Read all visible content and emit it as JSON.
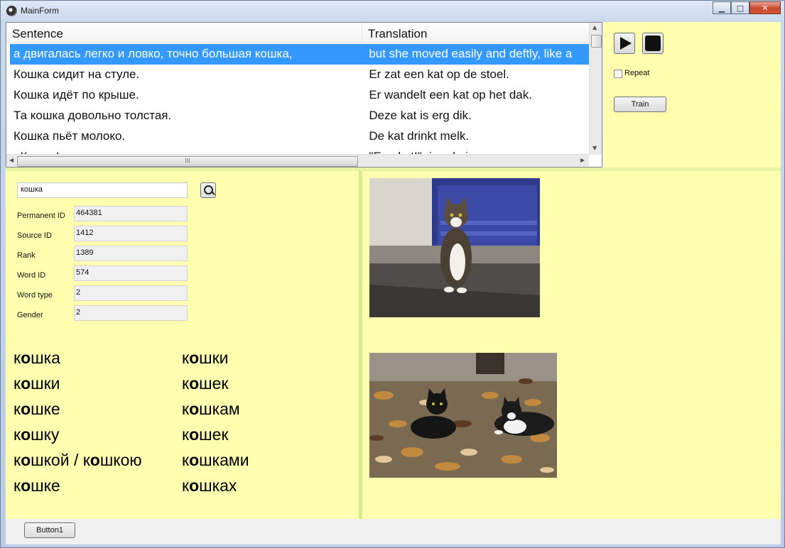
{
  "window": {
    "title": "MainForm",
    "close_glyph": "✕",
    "minimize_glyph": "▁",
    "maximize_glyph": "□"
  },
  "grid": {
    "columns": [
      "Sentence",
      "Translation"
    ],
    "rows": [
      {
        "sentence": "а двигалась легко и ловко, точно большая кошка,",
        "translation": "but she moved easily and deftly, like a"
      },
      {
        "sentence": "Кошка сидит на стуле.",
        "translation": "Er zat een kat op de stoel."
      },
      {
        "sentence": "Кошка идёт по крыше.",
        "translation": "Er wandelt een kat op het dak."
      },
      {
        "sentence": "Та кошка довольно толстая.",
        "translation": "Deze kat is erg dik."
      },
      {
        "sentence": "Кошка пьёт молоко.",
        "translation": "De kat drinkt melk."
      },
      {
        "sentence": "«Кошка!» — закричал мальчик.",
        "translation": "\"Een kat!\" riep de jongen."
      }
    ],
    "selected_index": 0,
    "vscroll_position": 0.02,
    "hscroll_thumb_grip": "III"
  },
  "controls": {
    "repeat_label": "Repeat",
    "repeat_checked": false,
    "train_label": "Train"
  },
  "search": {
    "value": "кошка"
  },
  "fields": [
    {
      "label": "Permanent ID",
      "value": "464381"
    },
    {
      "label": "Source ID",
      "value": "1412"
    },
    {
      "label": "Rank",
      "value": "1389"
    },
    {
      "label": "Word ID",
      "value": "574"
    },
    {
      "label": "Word type",
      "value": "2"
    },
    {
      "label": "Gender",
      "value": "2"
    }
  ],
  "forms": {
    "singular": [
      "кошка",
      "кошки",
      "кошке",
      "кошку",
      "кошкой / кошкою",
      "кошке"
    ],
    "plural": [
      "кошки",
      "кошек",
      "кошкам",
      "кошек",
      "кошками",
      "кошках"
    ]
  },
  "images": [
    {
      "subject": "tabby-and-white cat sitting on doorstep"
    },
    {
      "subject": "two black-and-white cats lying in autumn leaves"
    }
  ],
  "bottom": {
    "button1_label": "Button1"
  },
  "colors": {
    "panel_bg": "#ffffb0",
    "selection": "#3399ff"
  }
}
